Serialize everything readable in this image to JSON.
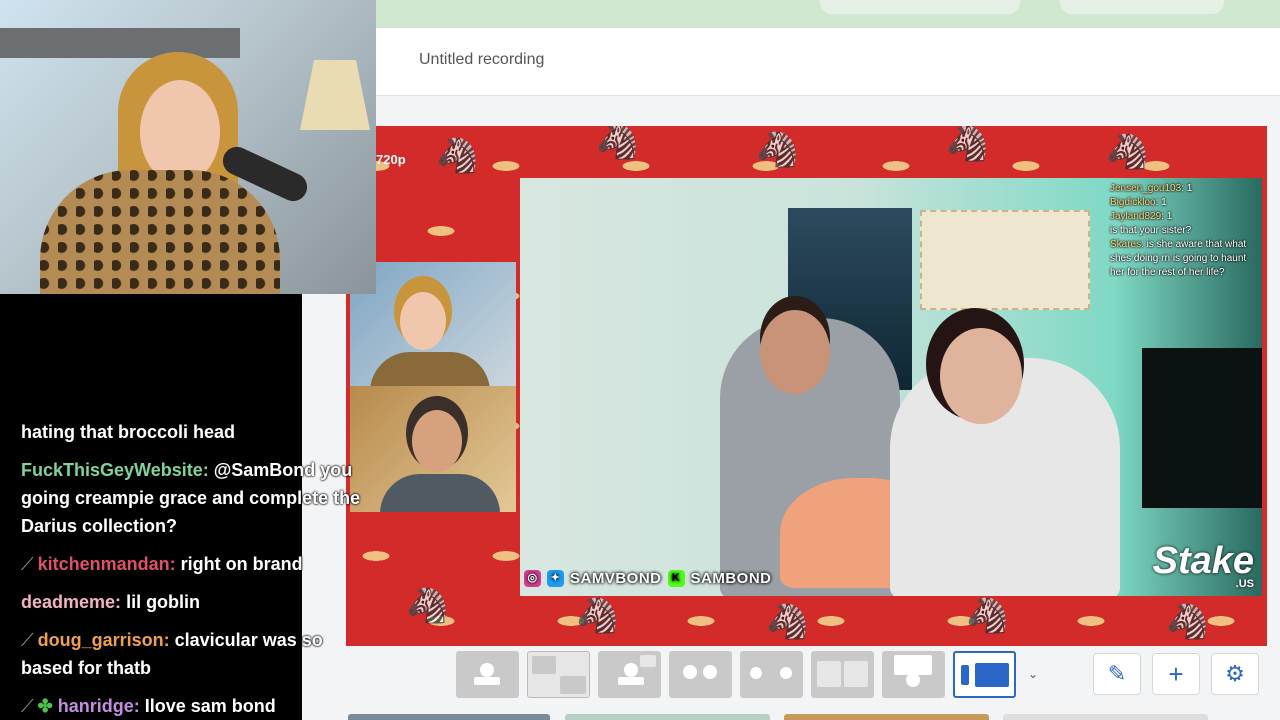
{
  "recording": {
    "title": "Untitled recording",
    "resolution": "720p"
  },
  "stream_overlay": {
    "chat": [
      {
        "user": "Jensen_gou103",
        "text": ": 1"
      },
      {
        "user": "Bigdickloo",
        "text": ": 1"
      },
      {
        "user": "Jayland829",
        "text": ": 1"
      },
      {
        "user": "",
        "text": "is that your sister?"
      },
      {
        "user": "Skares",
        "text": ": is she aware that what shes doing rn is going to haunt her for the rest of her life?"
      }
    ],
    "social_handles": [
      "SAMVBOND",
      "SAMBOND"
    ],
    "brand": "Stake",
    "brand_sub": ".US"
  },
  "chat_panel": {
    "messages": [
      {
        "user": "",
        "user_color": "#ffffff",
        "text": "hating that broccoli head",
        "icon": ""
      },
      {
        "user": "FuckThisGeyWebsite:",
        "user_color": "#7fd39b",
        "text": "@SamBond you going creampie grace and complete the Darius collection?",
        "icon": ""
      },
      {
        "user": "kitchenmandan:",
        "user_color": "#e0506a",
        "text": "right on brand",
        "icon": "slash"
      },
      {
        "user": "deadmeme:",
        "user_color": "#f2b3c6",
        "text": "lil goblin",
        "icon": ""
      },
      {
        "user": "doug_garrison:",
        "user_color": "#f0a04a",
        "text": "clavicular was so based for thatb",
        "icon": "slash"
      },
      {
        "user": "hanridge:",
        "user_color": "#c48de0",
        "text": "Ilove sam bond",
        "icon": "slash"
      }
    ]
  },
  "toolbar": {
    "layouts": [
      "single-speaker-layout",
      "screen-and-two-speakers-layout",
      "speaker-with-screen-layout",
      "two-speakers-layout",
      "two-speakers-split-layout",
      "two-speakers-grid-layout",
      "speaker-on-screen-layout",
      "screen-with-sidebar-layout"
    ],
    "active_layout": 7,
    "accent": "#2b66c9"
  }
}
